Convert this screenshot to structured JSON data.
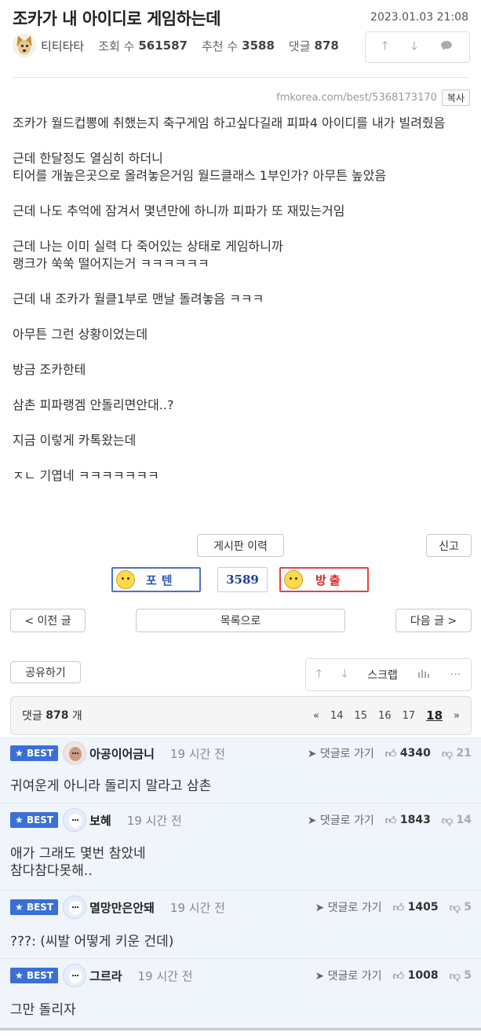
{
  "post": {
    "title": "조카가 내 아이디로 게임하는데",
    "date": "2023.01.03 21:08",
    "author": "티티타타",
    "views_label": "조회 수",
    "views": "561587",
    "recs_label": "추천 수",
    "recs": "3588",
    "comments_label": "댓글",
    "comments": "878",
    "url": "fmkorea.com/best/5368173170",
    "copy_label": "복사"
  },
  "body": [
    "조카가 월드컵뽕에 취했는지 축구게임 하고싶다길래 피파4 아이디를 내가 빌려줬음",
    "근데 한달정도 열심히 하더니\n티어를 개높은곳으로 올려놓은거임 월드클래스 1부인가? 아무튼 높았음",
    "근데 나도 추억에 잠겨서 몇년만에 하니까 피파가 또 재밌는거임",
    "근데 나는 이미 실력 다 죽어있는 상태로 게임하니까\n랭크가 쑥쑥 떨어지는거 ㅋㅋㅋㅋㅋㅋ",
    "근데 내 조카가 월클1부로 맨날 돌려놓음 ㅋㅋㅋ",
    "아무튼 그런 상황이었는데",
    "방금 조카한테",
    "삼촌 피파랭겜 안돌리면안대..?",
    "지금 이렇게 카톡왔는데",
    "ㅈㄴ 기엽네 ㅋㅋㅋㅋㅋㅋㅋ"
  ],
  "actions": {
    "history": "게시판 이력",
    "report": "신고",
    "poten": "포텐",
    "vote_count": "3589",
    "bangchul": "방출",
    "prev": "< 이전 글",
    "list": "목록으로",
    "next": "다음 글 >",
    "share": "공유하기",
    "scrap": "스크랩",
    "more": "···"
  },
  "comment_header": {
    "label": "댓글",
    "count": "878",
    "unit": "개",
    "first": "«",
    "pages": [
      "14",
      "15",
      "16",
      "17"
    ],
    "current": "18",
    "last": "»"
  },
  "comments": [
    {
      "badge": "BEST",
      "name": "아공이어금니",
      "time": "19 시간 전",
      "goto": "댓글로 가기",
      "likes": "4340",
      "dislikes": "21",
      "text": "귀여운게 아니라 돌리지 말라고 삼촌"
    },
    {
      "badge": "BEST",
      "name": "보혜",
      "time": "19 시간 전",
      "goto": "댓글로 가기",
      "likes": "1843",
      "dislikes": "14",
      "text": "애가 그래도 몇번 참았네\n참다참다못해.."
    },
    {
      "badge": "BEST",
      "name": "멸망만은안돼",
      "time": "19 시간 전",
      "goto": "댓글로 가기",
      "likes": "1405",
      "dislikes": "5",
      "text": "???: (씨발 어떻게 키운 건데)"
    },
    {
      "badge": "BEST",
      "name": "그르라",
      "time": "19 시간 전",
      "goto": "댓글로 가기",
      "likes": "1008",
      "dislikes": "5",
      "text": "그만 돌리자"
    }
  ],
  "colors": {
    "best_badge": "#3a6fd8",
    "comment_bg": "#f0f4fb",
    "poten": "#4a74c9",
    "bangchul": "#dd4444"
  }
}
